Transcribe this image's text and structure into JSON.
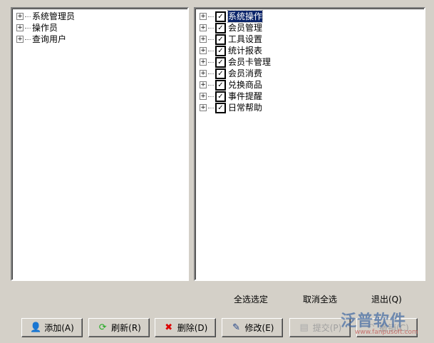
{
  "left_tree": [
    "系统管理员",
    "操作员",
    "查询用户"
  ],
  "right_tree": [
    "系统操作",
    "会员管理",
    "工具设置",
    "统计报表",
    "会员卡管理",
    "会员消费",
    "兑换商品",
    "事件提醒",
    "日常帮助"
  ],
  "links": {
    "select_all": "全选选定",
    "cancel_all": "取消全选",
    "exit": "退出(Q)"
  },
  "buttons": [
    {
      "label": "添加(A)",
      "icon": "add-user-icon"
    },
    {
      "label": "刷新(R)",
      "icon": "refresh-icon"
    },
    {
      "label": "删除(D)",
      "icon": "delete-user-icon"
    },
    {
      "label": "修改(E)",
      "icon": "edit-icon"
    },
    {
      "label": "提交(P)",
      "icon": "save-icon",
      "disabled": true
    },
    {
      "label": "撤销(C)",
      "icon": "undo-icon",
      "disabled": true
    }
  ],
  "watermark": {
    "title": "泛普软件",
    "url": "www.fanpusoft.com"
  }
}
